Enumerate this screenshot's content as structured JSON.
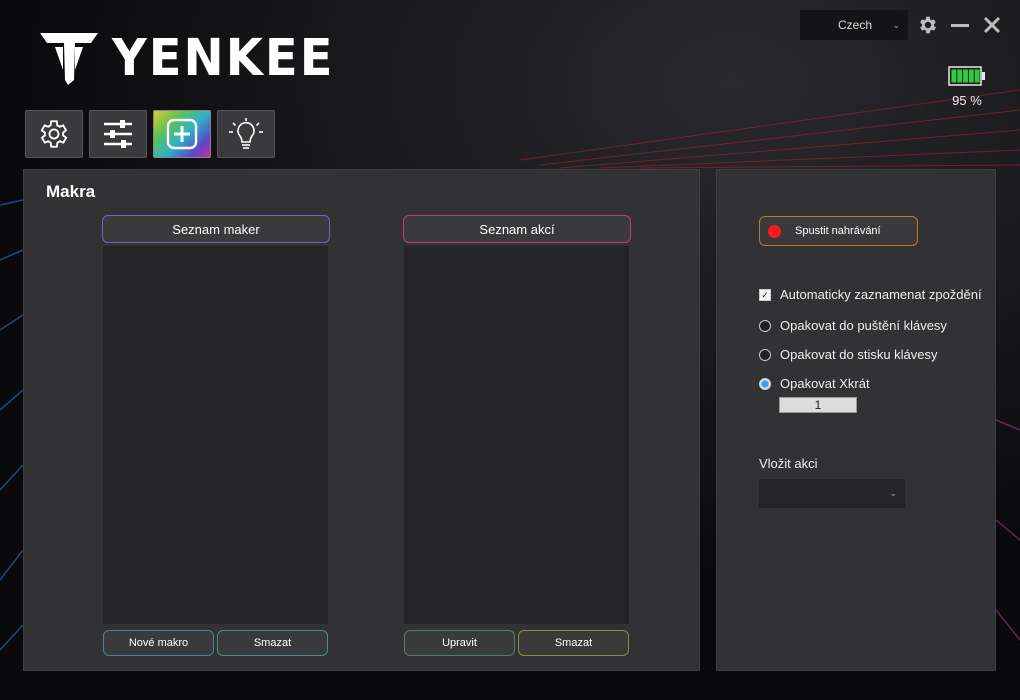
{
  "brand": {
    "name": "YENKEE"
  },
  "topbar": {
    "language": "Czech"
  },
  "battery": {
    "level": 95,
    "label": "95 %",
    "color": "#2ecc40"
  },
  "tabs": [
    {
      "icon": "gear-icon",
      "active": false
    },
    {
      "icon": "sliders-icon",
      "active": false
    },
    {
      "icon": "plus-square-icon",
      "active": true
    },
    {
      "icon": "lightbulb-icon",
      "active": false
    }
  ],
  "macro_panel": {
    "title": "Makra",
    "macro_list": {
      "header": "Seznam maker",
      "items": [],
      "new_label": "Nové makro",
      "delete_label": "Smazat"
    },
    "action_list": {
      "header": "Seznam akcí",
      "items": [],
      "edit_label": "Upravit",
      "delete_label": "Smazat"
    }
  },
  "settings_panel": {
    "record_label": "Spustit nahrávání",
    "auto_delay_label": "Automaticky zaznamenat zpoždění",
    "auto_delay_checked": true,
    "repeat_options": [
      {
        "label": "Opakovat do puštění klávesy",
        "selected": false
      },
      {
        "label": "Opakovat do stisku klávesy",
        "selected": false
      },
      {
        "label": "Opakovat Xkrát",
        "selected": true
      }
    ],
    "repeat_count": "1",
    "insert_action_label": "Vložit akci",
    "insert_action_value": ""
  },
  "colors": {
    "macro_list_border": "#6f63c8",
    "action_list_border": "#c23a78",
    "record_border": "#b07a47"
  }
}
